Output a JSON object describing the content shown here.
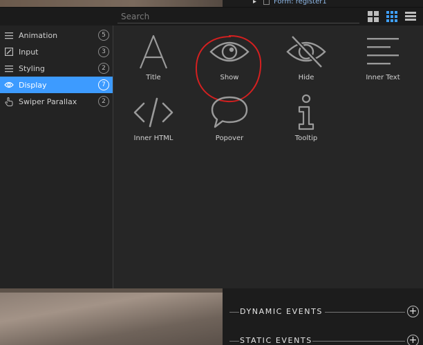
{
  "tree": {
    "row_label": "Form: register1"
  },
  "search": {
    "placeholder": "Search"
  },
  "view_toggles": [
    {
      "name": "large-grid",
      "active": false
    },
    {
      "name": "small-grid",
      "active": true
    },
    {
      "name": "list",
      "active": false
    }
  ],
  "sidebar": {
    "items": [
      {
        "label": "Animation",
        "count": "5",
        "icon": "list-icon"
      },
      {
        "label": "Input",
        "count": "3",
        "icon": "edit-icon"
      },
      {
        "label": "Styling",
        "count": "2",
        "icon": "list-icon"
      },
      {
        "label": "Display",
        "count": "7",
        "icon": "eye-icon",
        "active": true
      },
      {
        "label": "Swiper Parallax",
        "count": "2",
        "icon": "hand-pointer-icon"
      }
    ]
  },
  "tiles": [
    {
      "label": "Title",
      "icon": "letter-a-icon"
    },
    {
      "label": "Show",
      "icon": "eye-icon",
      "highlighted": true
    },
    {
      "label": "Hide",
      "icon": "eye-slash-icon"
    },
    {
      "label": "Inner Text",
      "icon": "text-lines-icon"
    },
    {
      "label": "Inner HTML",
      "icon": "code-icon"
    },
    {
      "label": "Popover",
      "icon": "speech-bubble-icon"
    },
    {
      "label": "Tooltip",
      "icon": "info-icon"
    }
  ],
  "events": [
    {
      "label": "DYNAMIC EVENTS"
    },
    {
      "label": "STATIC EVENTS"
    }
  ],
  "colors": {
    "accent": "#3d9bff",
    "highlight_circle": "#d42020",
    "icon_gray": "#9a9a9a"
  }
}
